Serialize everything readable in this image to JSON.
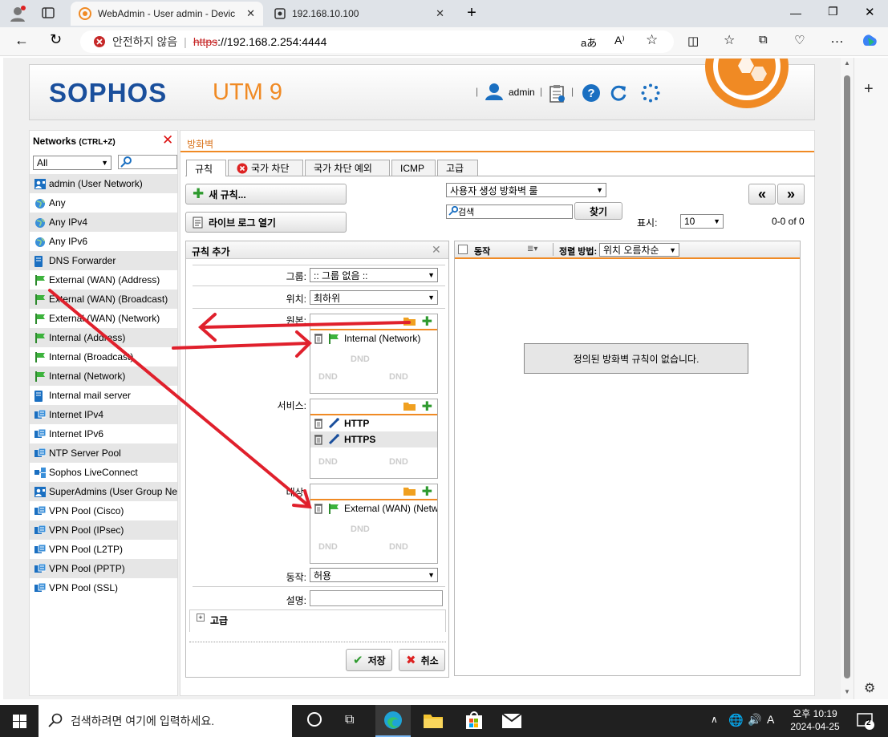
{
  "browser": {
    "tabs": [
      {
        "title": "WebAdmin - User admin - Devic",
        "active": true
      },
      {
        "title": "192.168.10.100",
        "active": false
      }
    ],
    "security_label": "안전하지 않음",
    "url_scheme": "https",
    "url_rest": "://192.168.2.254:4444"
  },
  "header": {
    "brand": "SOPHOS",
    "product": "UTM 9",
    "user": "admin"
  },
  "networks": {
    "title": "Networks",
    "shortcut": "(CTRL+Z)",
    "filter_value": "All",
    "items": [
      {
        "label": "admin (User Network)",
        "icon": "user-network-icon",
        "alt": true
      },
      {
        "label": "Any",
        "icon": "globe-icon",
        "alt": false
      },
      {
        "label": "Any IPv4",
        "icon": "globe-icon",
        "alt": true
      },
      {
        "label": "Any IPv6",
        "icon": "globe-icon",
        "alt": false
      },
      {
        "label": "DNS Forwarder",
        "icon": "server-icon",
        "alt": true
      },
      {
        "label": "External (WAN) (Address)",
        "icon": "interface-flag-icon",
        "alt": false
      },
      {
        "label": "External (WAN) (Broadcast)",
        "icon": "interface-flag-icon",
        "alt": true
      },
      {
        "label": "External (WAN) (Network)",
        "icon": "interface-flag-icon",
        "alt": false
      },
      {
        "label": "Internal (Address)",
        "icon": "interface-flag-icon",
        "alt": true
      },
      {
        "label": "Internal (Broadcast)",
        "icon": "interface-flag-icon",
        "alt": false
      },
      {
        "label": "Internal (Network)",
        "icon": "interface-flag-icon",
        "alt": true
      },
      {
        "label": "Internal mail server",
        "icon": "server-icon",
        "alt": false
      },
      {
        "label": "Internet IPv4",
        "icon": "network-icon",
        "alt": true
      },
      {
        "label": "Internet IPv6",
        "icon": "network-icon",
        "alt": false
      },
      {
        "label": "NTP Server Pool",
        "icon": "network-icon",
        "alt": true
      },
      {
        "label": "Sophos LiveConnect",
        "icon": "network-group-icon",
        "alt": false
      },
      {
        "label": "SuperAdmins (User Group Ne",
        "icon": "user-network-icon",
        "alt": true
      },
      {
        "label": "VPN Pool (Cisco)",
        "icon": "network-icon",
        "alt": false
      },
      {
        "label": "VPN Pool (IPsec)",
        "icon": "network-icon",
        "alt": true
      },
      {
        "label": "VPN Pool (L2TP)",
        "icon": "network-icon",
        "alt": false
      },
      {
        "label": "VPN Pool (PPTP)",
        "icon": "network-icon",
        "alt": true
      },
      {
        "label": "VPN Pool (SSL)",
        "icon": "network-icon",
        "alt": false
      }
    ]
  },
  "main": {
    "breadcrumb": "방화벽",
    "tabs": [
      "규칙",
      "국가 차단",
      "국가 차단 예외",
      "ICMP",
      "고급"
    ],
    "new_rule": "새 규칙...",
    "live_log": "라이브 로그 열기",
    "filter_select": "사용자 생성 방화벽 룰",
    "search_placeholder": "검색",
    "find_button": "찾기",
    "display_label": "표시:",
    "display_value": "10",
    "count": "0-0 of 0",
    "prev": "«",
    "next": "»",
    "add_rule": {
      "title": "규칙 추가",
      "group_label": "그룹:",
      "group_value": ":: 그룹 없음 ::",
      "position_label": "위치:",
      "position_value": "최하위",
      "source_label": "원본:",
      "source_items": [
        "Internal (Network)"
      ],
      "service_label": "서비스:",
      "service_items": [
        "HTTP",
        "HTTPS"
      ],
      "dest_label": "대상:",
      "dest_items": [
        "External (WAN) (Netw"
      ],
      "dnd": "DND",
      "action_label": "동작:",
      "action_value": "허용",
      "comment_label": "설명:",
      "advanced": "고급",
      "save": "저장",
      "cancel": "취소"
    },
    "list": {
      "action_col": "동작",
      "sort_label": "정렬 방법:",
      "sort_value": "위치 오름차순",
      "empty": "정의된 방화벽 규칙이 없습니다."
    }
  },
  "taskbar": {
    "search_placeholder": "검색하려면 여기에 입력하세요.",
    "time": "오후 10:19",
    "date": "2024-04-25",
    "notif_count": "2"
  },
  "colors": {
    "accent": "#f08a24",
    "brand": "#1a4f9c",
    "arrow": "#e0202c"
  }
}
